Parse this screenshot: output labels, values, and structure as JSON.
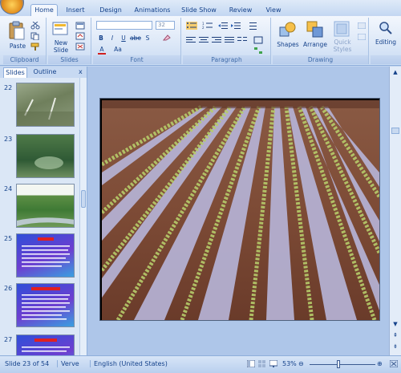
{
  "ribbon": {
    "tabs": [
      "Home",
      "Insert",
      "Design",
      "Animations",
      "Slide Show",
      "Review",
      "View"
    ],
    "active_tab": "Home",
    "groups": {
      "clipboard": {
        "label": "Clipboard",
        "paste": "Paste"
      },
      "slides": {
        "label": "Slides",
        "new_slide": "New Slide"
      },
      "font": {
        "label": "Font",
        "font_size": "32",
        "bold": "B",
        "italic": "I",
        "underline": "U",
        "strike": "abe",
        "shadow": "S",
        "font_color": "A",
        "aa": "Aa"
      },
      "paragraph": {
        "label": "Paragraph"
      },
      "drawing": {
        "label": "Drawing",
        "shapes": "Shapes",
        "arrange": "Arrange",
        "quick_styles": "Quick Styles"
      },
      "editing": {
        "label": "Editing"
      }
    }
  },
  "pane": {
    "tab_slides": "Slides",
    "tab_outline": "Outline",
    "close": "x"
  },
  "thumbnails": [
    {
      "num": "22"
    },
    {
      "num": "23"
    },
    {
      "num": "24"
    },
    {
      "num": "25"
    },
    {
      "num": "26"
    },
    {
      "num": "27"
    }
  ],
  "status": {
    "slide_info": "Slide 23 of 54",
    "theme": "Verve",
    "language": "English (United States)",
    "zoom": "53%"
  },
  "colors": {
    "thumb_purple": "#5b4bd6",
    "thumb_red": "#d92020",
    "ribbon_text": "#15428b"
  }
}
